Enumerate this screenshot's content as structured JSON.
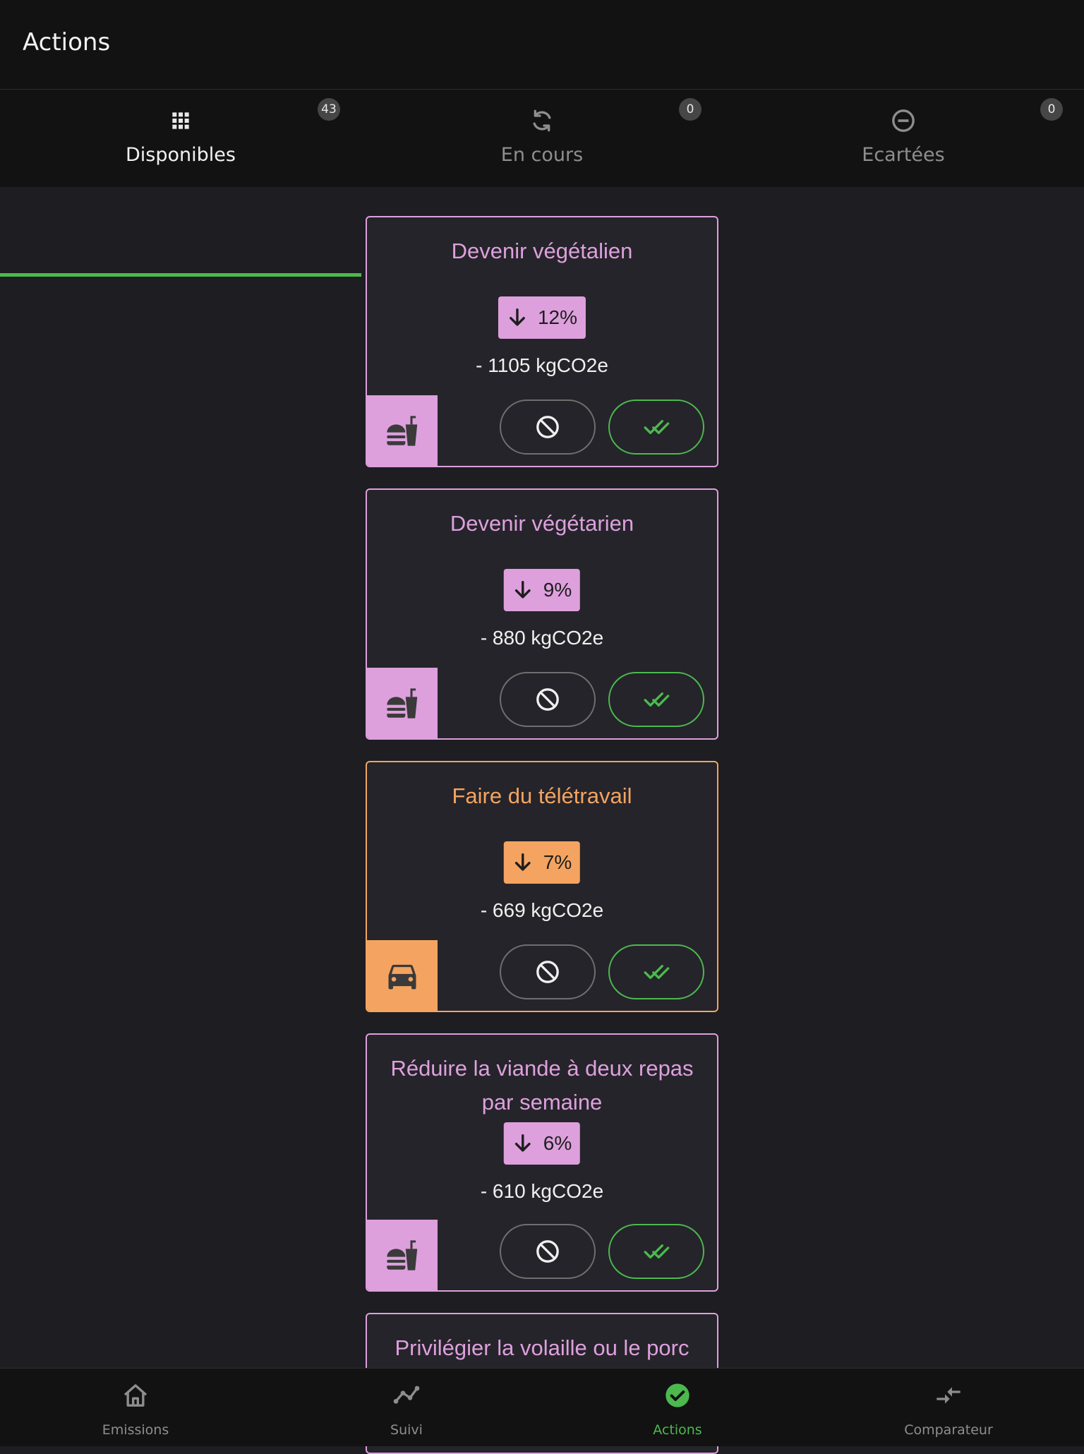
{
  "header": {
    "title": "Actions"
  },
  "tabs": [
    {
      "label": "Disponibles",
      "badge": "43",
      "icon": "grid-icon",
      "active": true
    },
    {
      "label": "En cours",
      "badge": "0",
      "icon": "sync-icon",
      "active": false
    },
    {
      "label": "Ecartées",
      "badge": "0",
      "icon": "minus-circle-icon",
      "active": false
    }
  ],
  "colors": {
    "food": "#dda0dd",
    "transport": "#f4a460",
    "accent": "#4cb94f"
  },
  "cards": [
    {
      "title": "Devenir végétalien",
      "percent": "12%",
      "reduction": "- 1105 kgCO2e",
      "category": "food",
      "category_icon": "fast-food-icon"
    },
    {
      "title": "Devenir végétarien",
      "percent": "9%",
      "reduction": "- 880 kgCO2e",
      "category": "food",
      "category_icon": "fast-food-icon"
    },
    {
      "title": "Faire du télétravail",
      "percent": "7%",
      "reduction": "- 669 kgCO2e",
      "category": "transport",
      "category_icon": "car-icon"
    },
    {
      "title": "Réduire la viande à deux repas par semaine",
      "percent": "6%",
      "reduction": "- 610 kgCO2e",
      "category": "food",
      "category_icon": "fast-food-icon"
    },
    {
      "title": "Privilégier la volaille ou le porc",
      "category": "food"
    }
  ],
  "bottom_nav": [
    {
      "label": "Emissions",
      "icon": "home-icon",
      "active": false
    },
    {
      "label": "Suivi",
      "icon": "trend-line-icon",
      "active": false
    },
    {
      "label": "Actions",
      "icon": "check-circle-icon",
      "active": true
    },
    {
      "label": "Comparateur",
      "icon": "compare-arrows-icon",
      "active": false
    }
  ]
}
